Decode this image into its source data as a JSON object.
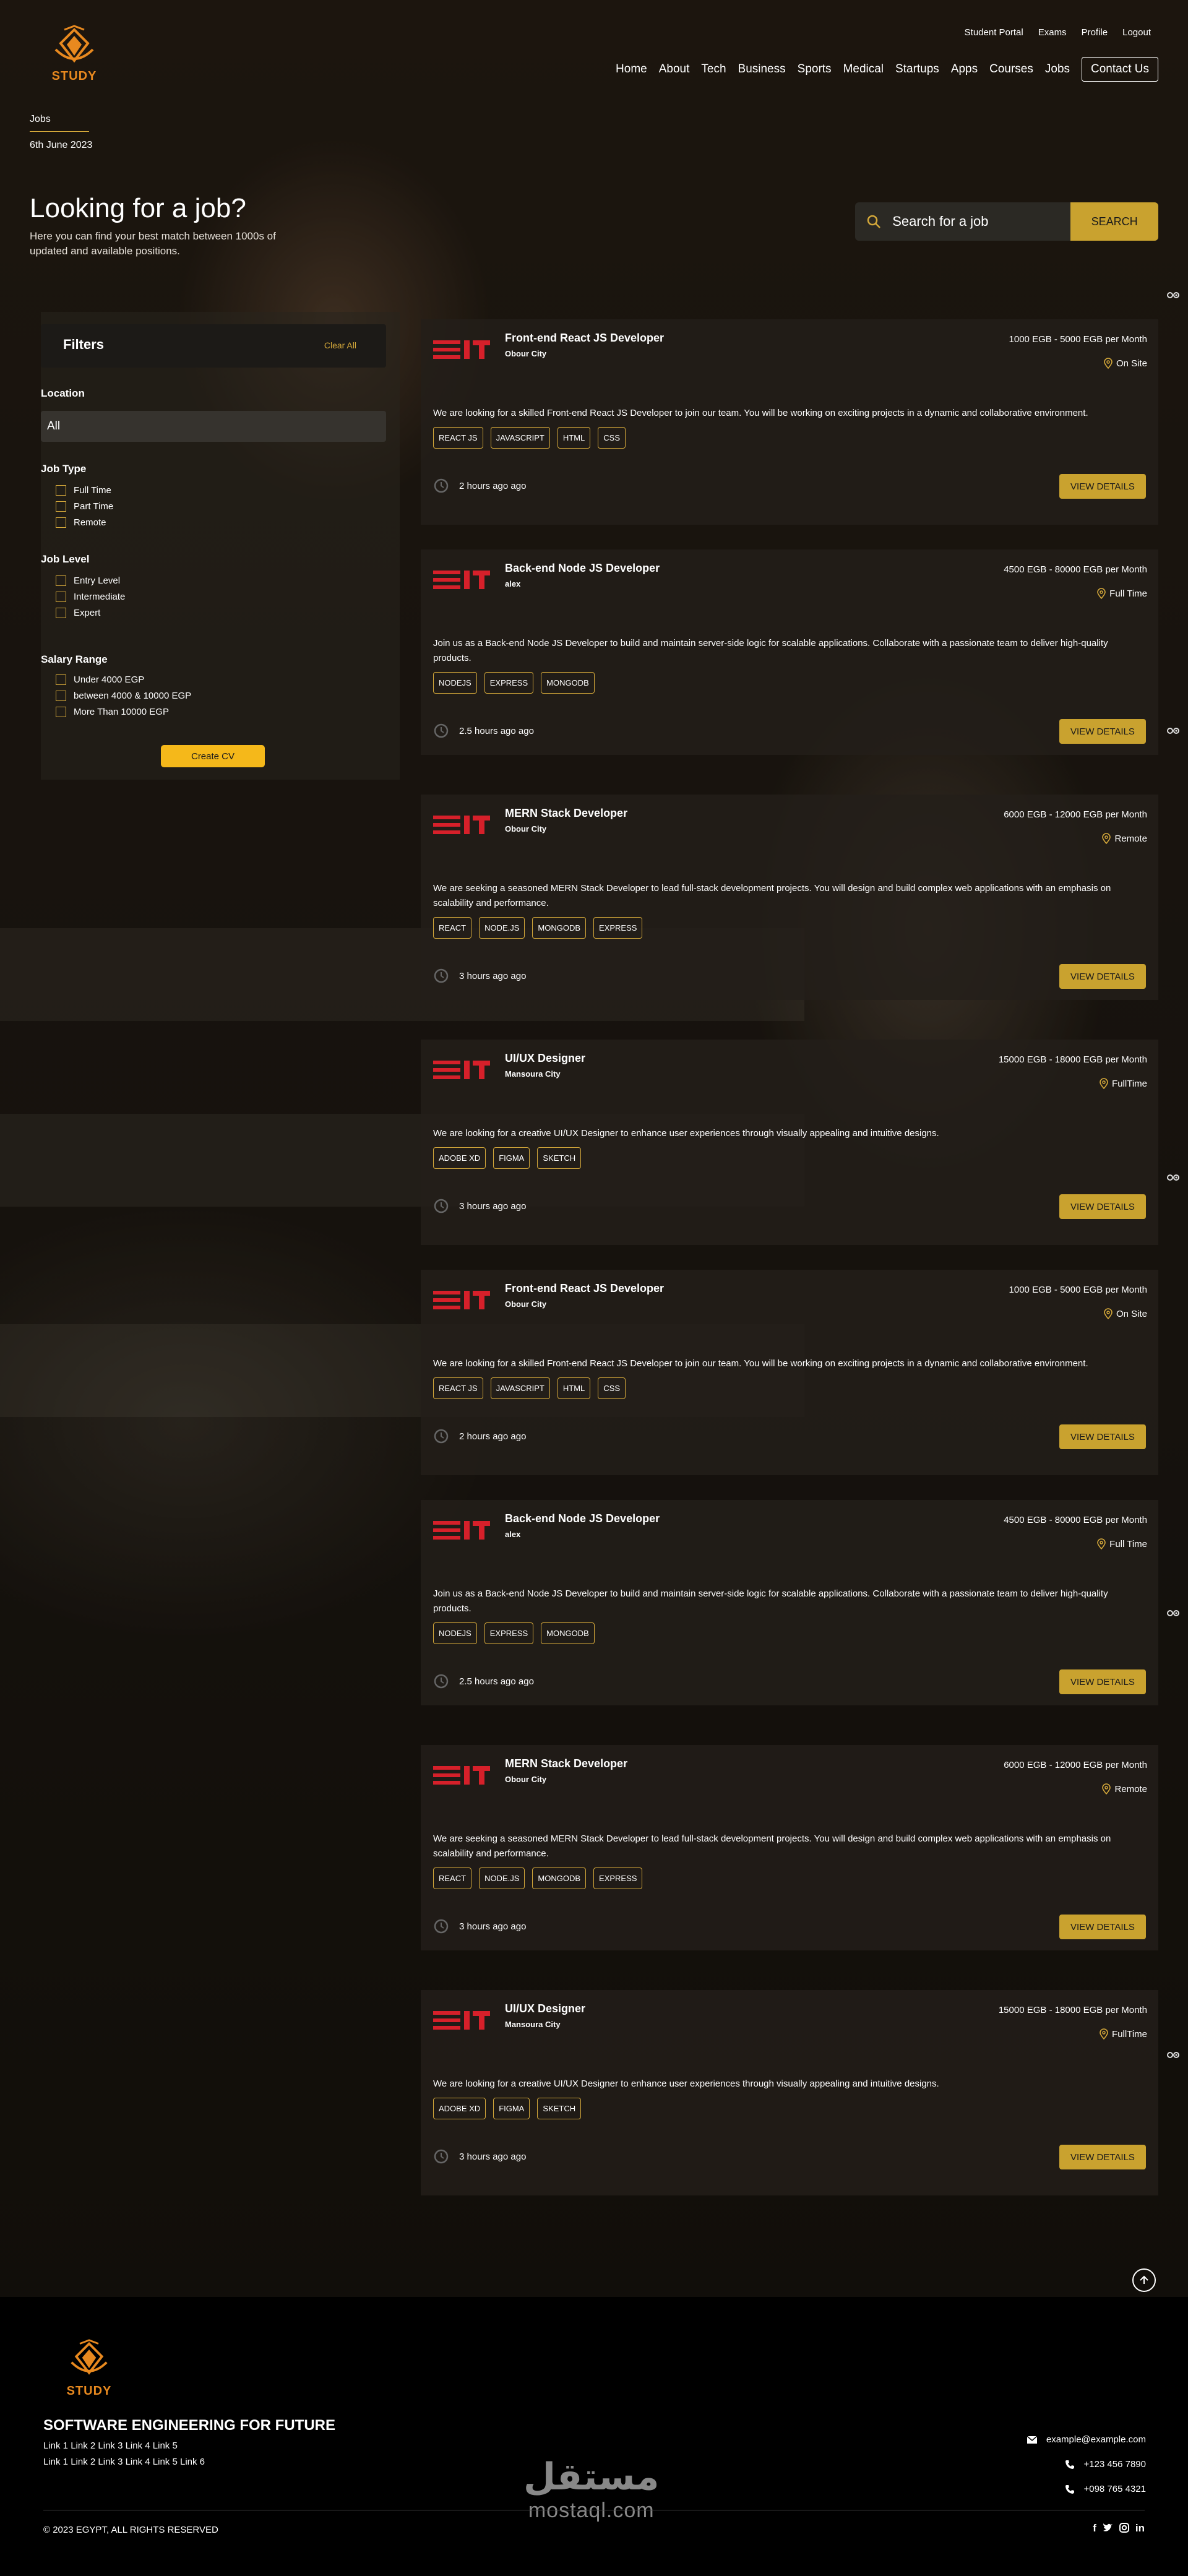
{
  "brand": {
    "name": "STUDY",
    "color": "#e8891f"
  },
  "top_links": [
    "Student Portal",
    "Exams",
    "Profile",
    "Logout"
  ],
  "nav": [
    "Home",
    "About",
    "Tech",
    "Business",
    "Sports",
    "Medical",
    "Startups",
    "Apps",
    "Courses",
    "Jobs"
  ],
  "nav_contact": "Contact Us",
  "breadcrumb": "Jobs",
  "date": "6th June 2023",
  "hero": {
    "title": "Looking for a job?",
    "subtitle": "Here you can find your best match between 1000s of updated and available positions."
  },
  "search": {
    "placeholder": "Search for a job",
    "button": "SEARCH"
  },
  "filters": {
    "title": "Filters",
    "clear": "Clear All",
    "location_label": "Location",
    "location_value": "All",
    "job_type_label": "Job Type",
    "job_type": [
      "Full Time",
      "Part Time",
      "Remote"
    ],
    "job_level_label": "Job Level",
    "job_level": [
      "Entry Level",
      "Intermediate",
      "Expert"
    ],
    "salary_label": "Salary Range",
    "salary": [
      "Under 4000 EGP",
      "between 4000 & 10000 EGP",
      "More Than 10000 EGP"
    ],
    "create_cv": "Create CV"
  },
  "jobs": [
    {
      "title": "Front-end React JS Developer",
      "company": "Obour City",
      "salary": "1000 EGB - 5000 EGB per Month",
      "location": "On Site",
      "description": "We are looking for a skilled Front-end React JS Developer to join our team. You will be working on exciting projects in a dynamic and collaborative environment.",
      "tags": [
        "REACT JS",
        "JAVASCRIPT",
        "HTML",
        "CSS"
      ],
      "time": "2 hours ago ago",
      "button": "VIEW DETAILS"
    },
    {
      "title": "Back-end Node JS Developer",
      "company": "alex",
      "salary": "4500 EGB - 80000 EGB per Month",
      "location": "Full Time",
      "description": "Join us as a Back-end Node JS Developer to build and maintain server-side logic for scalable applications. Collaborate with a passionate team to deliver high-quality products.",
      "tags": [
        "NODEJS",
        "EXPRESS",
        "MONGODB"
      ],
      "time": "2.5 hours ago ago",
      "button": "VIEW DETAILS"
    },
    {
      "title": "MERN Stack Developer",
      "company": "Obour City",
      "salary": "6000 EGB - 12000 EGB per Month",
      "location": "Remote",
      "description": "We are seeking a seasoned MERN Stack Developer to lead full-stack development projects. You will design and build complex web applications with an emphasis on scalability and performance.",
      "tags": [
        "REACT",
        "NODE.JS",
        "MONGODB",
        "EXPRESS"
      ],
      "time": "3 hours ago ago",
      "button": "VIEW DETAILS"
    },
    {
      "title": "UI/UX Designer",
      "company": "Mansoura City",
      "salary": "15000 EGB - 18000 EGB per Month",
      "location": "FullTime",
      "description": "We are looking for a creative UI/UX Designer to enhance user experiences through visually appealing and intuitive designs.",
      "tags": [
        "ADOBE XD",
        "FIGMA",
        "SKETCH"
      ],
      "time": "3 hours ago ago",
      "button": "VIEW DETAILS"
    },
    {
      "title": "Front-end React JS Developer",
      "company": "Obour City",
      "salary": "1000 EGB - 5000 EGB per Month",
      "location": "On Site",
      "description": "We are looking for a skilled Front-end React JS Developer to join our team. You will be working on exciting projects in a dynamic and collaborative environment.",
      "tags": [
        "REACT JS",
        "JAVASCRIPT",
        "HTML",
        "CSS"
      ],
      "time": "2 hours ago ago",
      "button": "VIEW DETAILS"
    },
    {
      "title": "Back-end Node JS Developer",
      "company": "alex",
      "salary": "4500 EGB - 80000 EGB per Month",
      "location": "Full Time",
      "description": "Join us as a Back-end Node JS Developer to build and maintain server-side logic for scalable applications. Collaborate with a passionate team to deliver high-quality products.",
      "tags": [
        "NODEJS",
        "EXPRESS",
        "MONGODB"
      ],
      "time": "2.5 hours ago ago",
      "button": "VIEW DETAILS"
    },
    {
      "title": "MERN Stack Developer",
      "company": "Obour City",
      "salary": "6000 EGB - 12000 EGB per Month",
      "location": "Remote",
      "description": "We are seeking a seasoned MERN Stack Developer to lead full-stack development projects. You will design and build complex web applications with an emphasis on scalability and performance.",
      "tags": [
        "REACT",
        "NODE.JS",
        "MONGODB",
        "EXPRESS"
      ],
      "time": "3 hours ago ago",
      "button": "VIEW DETAILS"
    },
    {
      "title": "UI/UX Designer",
      "company": "Mansoura City",
      "salary": "15000 EGB - 18000 EGB per Month",
      "location": "FullTime",
      "description": "We are looking for a creative UI/UX Designer to enhance user experiences through visually appealing and intuitive designs.",
      "tags": [
        "ADOBE XD",
        "FIGMA",
        "SKETCH"
      ],
      "time": "3 hours ago ago",
      "button": "VIEW DETAILS"
    }
  ],
  "footer": {
    "brand": "STUDY",
    "tagline": "SOFTWARE ENGINEERING FOR FUTURE",
    "links_row1": "Link 1 Link 2 Link 3 Link 4 Link 5",
    "links_row2": "Link 1 Link 2 Link 3 Link 4 Link 5 Link 6",
    "email": "example@example.com",
    "phone1": "+123 456 7890",
    "phone2": "+098 765 4321",
    "copyright": "© 2023 EGYPT, ALL RIGHTS RESERVED",
    "watermark_ar": "مستقل",
    "watermark_en": "mostaql.com",
    "social_icons": [
      "facebook-icon",
      "twitter-icon",
      "instagram-icon",
      "linkedin-icon"
    ]
  },
  "colors": {
    "accent": "#c9a22f",
    "brand_orange": "#e8891f",
    "company_red": "#d6202a"
  }
}
